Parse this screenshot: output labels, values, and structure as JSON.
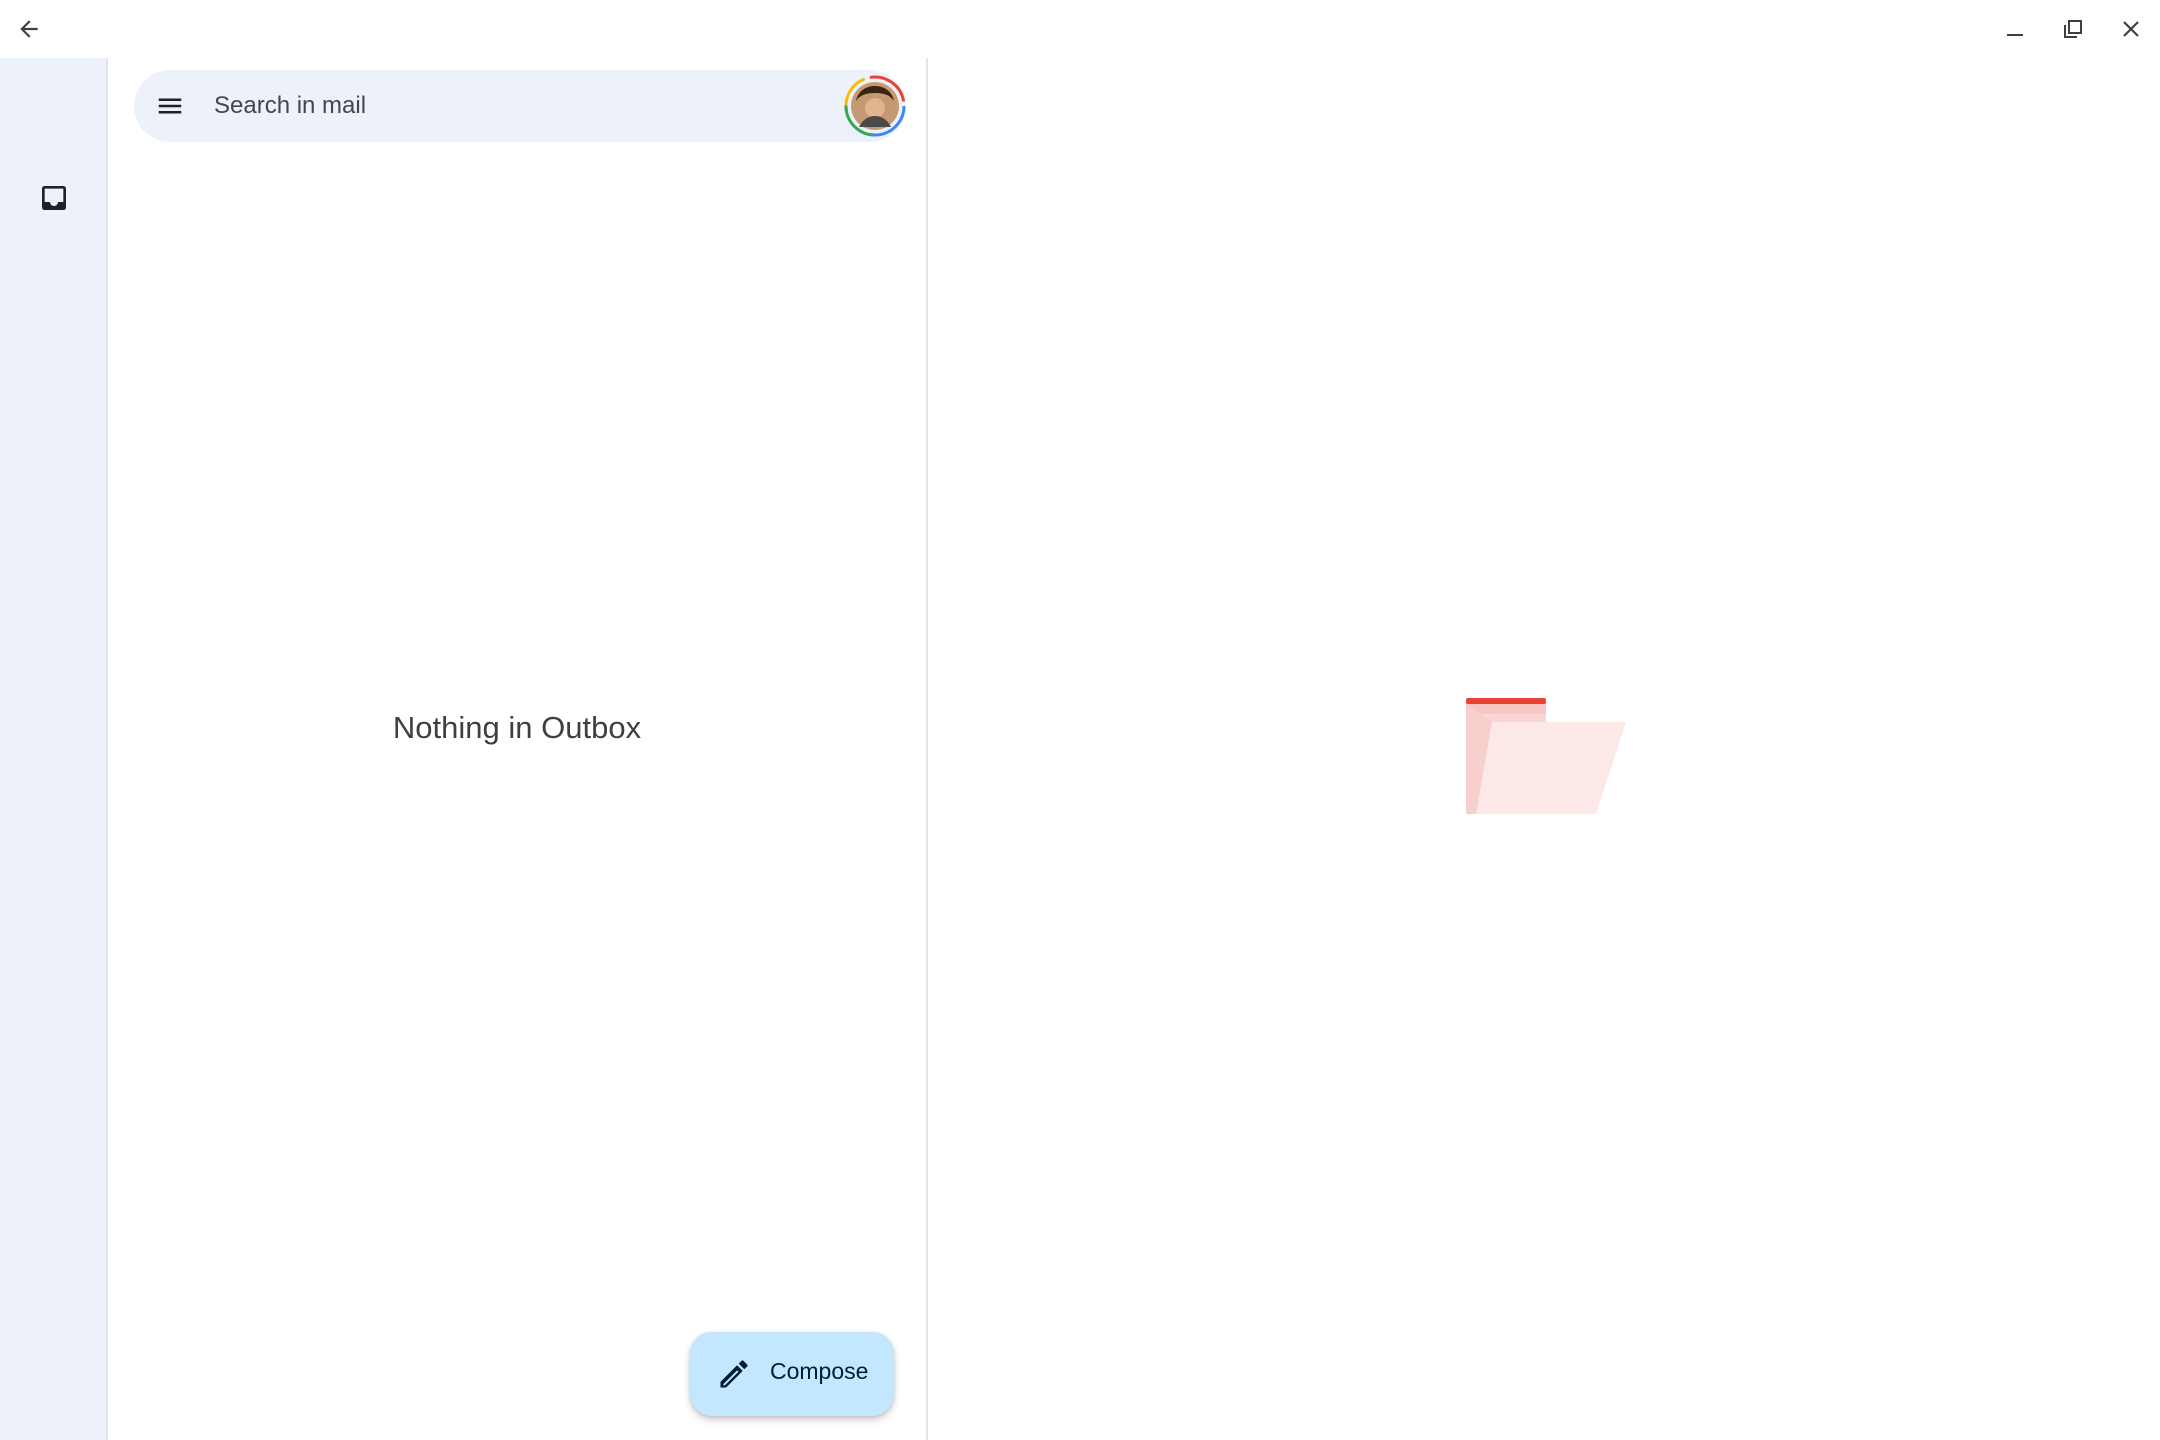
{
  "window": {
    "back_icon": "arrow-left-icon",
    "minimize_icon": "minimize-icon",
    "restore_icon": "restore-icon",
    "close_icon": "close-icon"
  },
  "rail": {
    "items": [
      {
        "icon": "inbox-icon"
      }
    ]
  },
  "search": {
    "placeholder": "Search in mail",
    "menu_icon": "hamburger-menu-icon",
    "avatar": "account-avatar"
  },
  "list": {
    "empty_message": "Nothing in Outbox"
  },
  "compose": {
    "label": "Compose",
    "icon": "pencil-icon",
    "background": "#c2e7ff"
  },
  "reading_pane": {
    "illustration": "folder-icon",
    "accent": "#ea4335"
  },
  "colors": {
    "rail_bg": "#edf2fa",
    "search_bg": "#edf2fa"
  }
}
